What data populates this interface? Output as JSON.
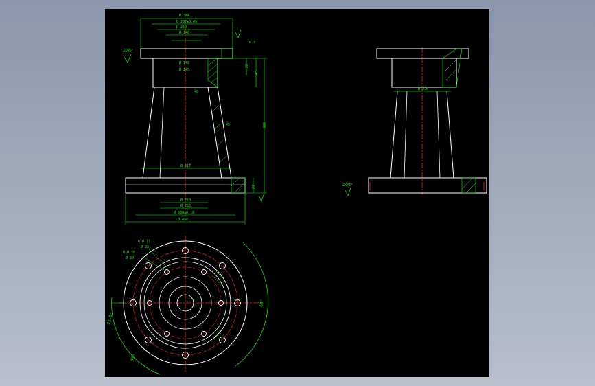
{
  "colors": {
    "geometry": "#ffffff",
    "dimension": "#00ff00",
    "centerline": "#ff2020",
    "hatch": "#00ff00",
    "background": "#000000"
  },
  "front_view": {
    "dims": {
      "d_top_outer": "Ø 344",
      "d_top_fit": "Ø 287±0.05",
      "d_top_inner": "Ø 250",
      "d_top_mid": "Ø 140",
      "d_bore": "Ø 148",
      "d_bore2": "Ø 145",
      "d_base_inner": "Ø 317",
      "d_base_bore": "Ø 250",
      "d_base_bore2": "Ø 253",
      "d_base_fit": "Ø 390±0.10",
      "d_base_outer": "Ø 458",
      "chamfer": "2X45°",
      "height_total": "380",
      "height_a": "45",
      "height_b": "28",
      "flange_t": "27",
      "angle": "45",
      "taper": "40",
      "roughness": "6.3"
    }
  },
  "side_view": {
    "dims": {
      "d_mid": "Ø 210",
      "chamfer": "2X45°"
    }
  },
  "plan_view": {
    "dims": {
      "holes_a": "6-Ø 17",
      "holes_a_cb": "Ø 23",
      "holes_b": "8-Ø 28",
      "holes_b_cb": "Ø 20",
      "angle_a": "60°",
      "angle_b": "22.5°",
      "angle_c": "45°"
    }
  }
}
